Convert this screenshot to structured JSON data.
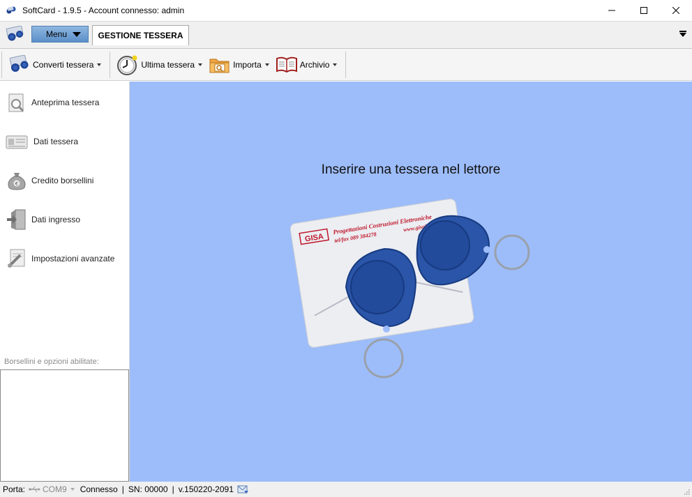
{
  "window": {
    "title": "SoftCard - 1.9.5 - Account connesso: admin",
    "minimize_icon": "minimize-icon",
    "maximize_icon": "maximize-icon",
    "close_icon": "close-icon"
  },
  "menubar": {
    "menu_label": "Menu",
    "active_tab": "GESTIONE TESSERA"
  },
  "toolbar": {
    "items": [
      {
        "label": "Converti tessera",
        "icon": "card-convert-icon"
      },
      {
        "label": "Ultima tessera",
        "icon": "clock-icon"
      },
      {
        "label": "Importa",
        "icon": "folder-search-icon"
      },
      {
        "label": "Archivio",
        "icon": "book-icon"
      }
    ]
  },
  "sidebar": {
    "items": [
      {
        "label": "Anteprima tessera",
        "icon": "card-preview-icon"
      },
      {
        "label": "Dati tessera",
        "icon": "id-card-icon"
      },
      {
        "label": "Credito borsellini",
        "icon": "money-bag-icon"
      },
      {
        "label": "Dati ingresso",
        "icon": "door-enter-icon"
      },
      {
        "label": "Impostazioni avanzate",
        "icon": "settings-pen-icon"
      }
    ],
    "footer_label": "Borsellini e opzioni abilitate:"
  },
  "main": {
    "prompt": "Inserire una tessera nel lettore",
    "card_brand": "GISA",
    "card_line1": "Progettazioni Costruzioni Elettroniche",
    "card_line2": "tel/fax 089 384278",
    "card_line3": "www.gisaitalia.it"
  },
  "status": {
    "porta_label": "Porta:",
    "port": "COM9",
    "connection": "Connesso",
    "serial": "SN: 00000",
    "version": "v.150220-2091"
  },
  "colors": {
    "main_bg": "#9dbdfa",
    "menu_button": "#6b9bd2",
    "fob_blue": "#2a55a8",
    "card_text_red": "#c0172b"
  }
}
